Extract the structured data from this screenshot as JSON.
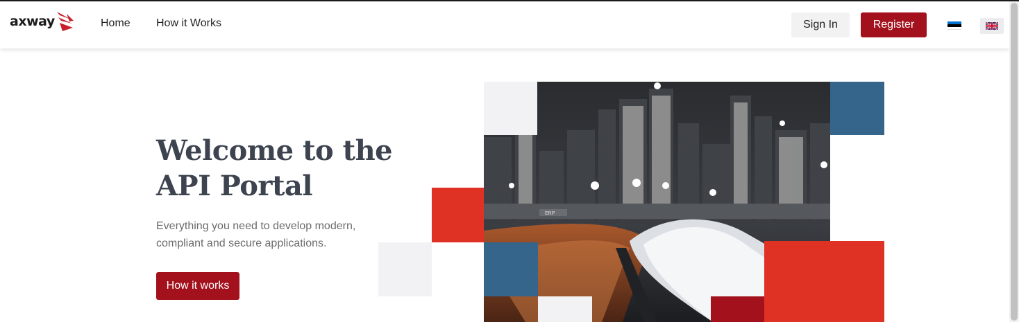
{
  "header": {
    "logo_text": "axway",
    "nav": [
      {
        "label": "Home"
      },
      {
        "label": "How it Works"
      }
    ],
    "sign_in_label": "Sign In",
    "register_label": "Register",
    "languages": [
      {
        "icon": "estonia-flag-icon",
        "colors": [
          "#0072ce",
          "#000000",
          "#ffffff"
        ]
      },
      {
        "icon": "uk-flag-icon",
        "colors": [
          "#012169",
          "#ffffff",
          "#c8102e"
        ]
      }
    ]
  },
  "hero": {
    "title_line1": "Welcome to the",
    "title_line2": "API Portal",
    "subtitle_line1": "Everything you need to develop modern,",
    "subtitle_line2": "compliant and secure applications.",
    "cta_label": "How it works",
    "image_sign_text": "ERP"
  },
  "theme": {
    "brand_red": "#a3111d",
    "accent_red": "#e03125",
    "accent_blue": "#35658a",
    "light_gray": "#f2f2f4",
    "title_color": "#3d4450"
  }
}
